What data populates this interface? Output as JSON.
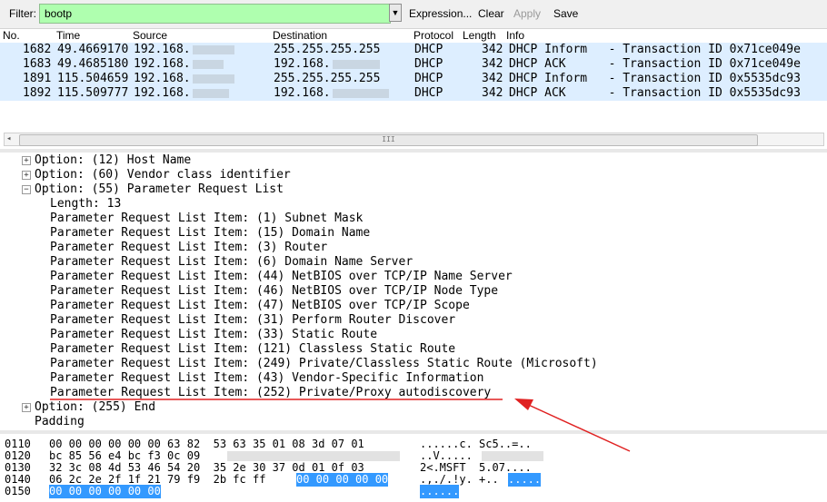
{
  "toolbar": {
    "filter_label": "Filter:",
    "filter_value": "bootp",
    "expression_label": "Expression...",
    "clear_label": "Clear",
    "apply_label": "Apply",
    "save_label": "Save"
  },
  "packet_list": {
    "columns": [
      "No.",
      "Time",
      "Source",
      "Destination",
      "Protocol",
      "Length",
      "Info"
    ],
    "rows": [
      {
        "no": "1682",
        "time": "49.4669170",
        "source": "192.168.",
        "destination": "255.255.255.255",
        "protocol": "DHCP",
        "length": "342",
        "info": "DHCP Inform   - Transaction ID 0x71ce049e"
      },
      {
        "no": "1683",
        "time": "49.4685180",
        "source": "192.168.",
        "destination": "192.168.",
        "protocol": "DHCP",
        "length": "342",
        "info": "DHCP ACK      - Transaction ID 0x71ce049e"
      },
      {
        "no": "1891",
        "time": "115.504659",
        "source": "192.168.",
        "destination": "255.255.255.255",
        "protocol": "DHCP",
        "length": "342",
        "info": "DHCP Inform   - Transaction ID 0x5535dc93"
      },
      {
        "no": "1892",
        "time": "115.509777",
        "source": "192.168.",
        "destination": "192.168.",
        "protocol": "DHCP",
        "length": "342",
        "info": "DHCP ACK      - Transaction ID 0x5535dc93"
      }
    ],
    "scroll_thumb_grip": "III",
    "scroll_left_arrow": "◂"
  },
  "details": {
    "opt12": "Option: (12) Host Name",
    "opt60": "Option: (60) Vendor class identifier",
    "opt55": "Option: (55) Parameter Request List",
    "length": "Length: 13",
    "items": [
      "Parameter Request List Item: (1) Subnet Mask",
      "Parameter Request List Item: (15) Domain Name",
      "Parameter Request List Item: (3) Router",
      "Parameter Request List Item: (6) Domain Name Server",
      "Parameter Request List Item: (44) NetBIOS over TCP/IP Name Server",
      "Parameter Request List Item: (46) NetBIOS over TCP/IP Node Type",
      "Parameter Request List Item: (47) NetBIOS over TCP/IP Scope",
      "Parameter Request List Item: (31) Perform Router Discover",
      "Parameter Request List Item: (33) Static Route",
      "Parameter Request List Item: (121) Classless Static Route",
      "Parameter Request List Item: (249) Private/Classless Static Route (Microsoft)",
      "Parameter Request List Item: (43) Vendor-Specific Information",
      "Parameter Request List Item: (252) Private/Proxy autodiscovery"
    ],
    "opt255": "Option: (255) End",
    "padding": "Padding",
    "expand_plus": "+",
    "expand_minus": "−"
  },
  "hex": {
    "rows": [
      {
        "offset": "0110",
        "hex": "00 00 00 00 00 00 63 82  53 63 35 01 08 3d 07 01",
        "ascii": "......c. Sc5..=.."
      },
      {
        "offset": "0120",
        "hex": "bc 85 56 e4 bc f3 0c 09",
        "ascii": "..V....."
      },
      {
        "offset": "0130",
        "hex": "32 3c 08 4d 53 46 54 20  35 2e 30 37 0d 01 0f 03",
        "ascii": "2<.MSFT  5.07...."
      },
      {
        "offset": "0140",
        "hex_plain": "06 2c 2e 2f 1f 21 79 f9  2b fc ff",
        "hex_sel": "00 00 00 00 00",
        "ascii_plain": ".,./.!y. +..",
        "ascii_sel": "....."
      },
      {
        "offset": "0150",
        "hex_sel": "00 00 00 00 00 00",
        "ascii_sel": "......"
      }
    ]
  },
  "colors": {
    "filter_bg": "#afffaf",
    "row_bg": "#ddeeff",
    "selection": "#3399ff",
    "annotation": "#e02020"
  }
}
